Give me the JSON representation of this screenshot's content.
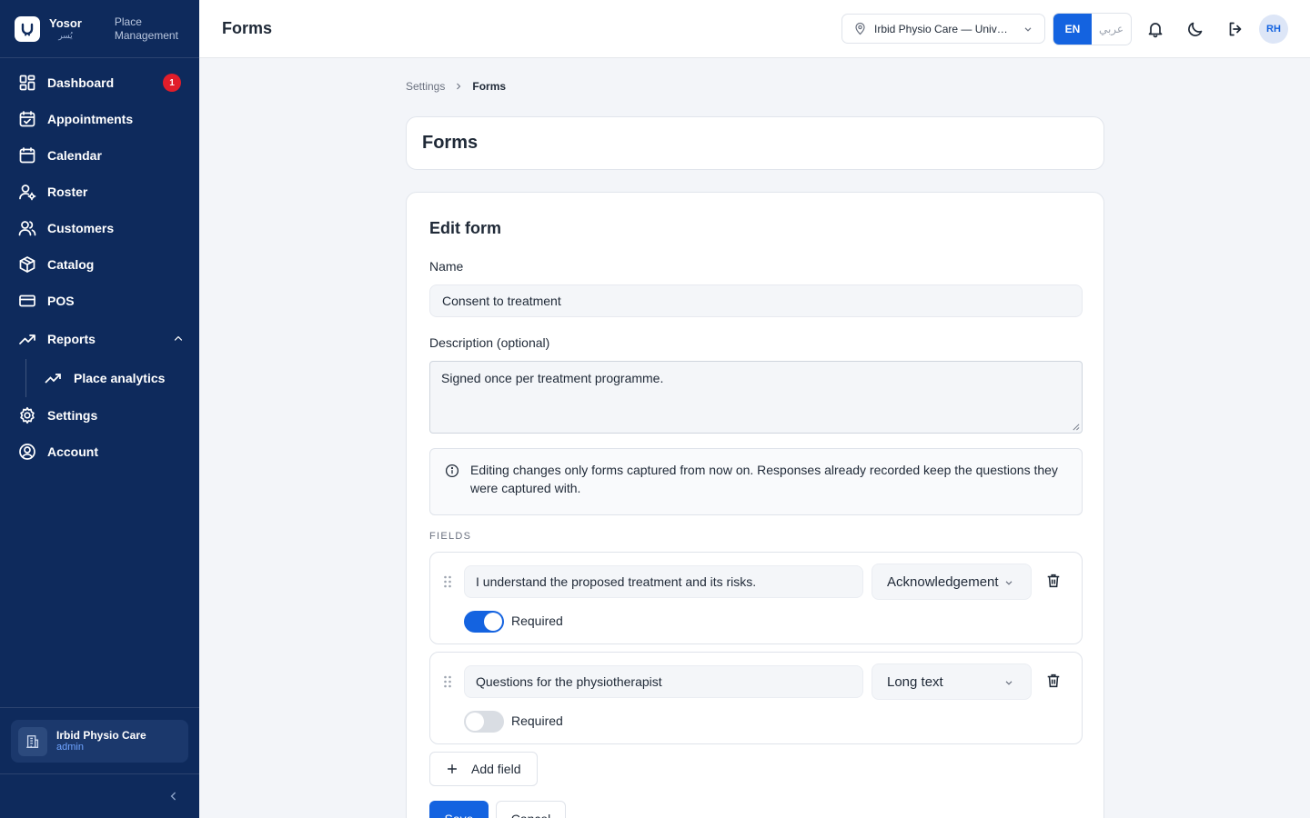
{
  "brand": {
    "name": "Yosor",
    "name_ar": "يُسر",
    "subtitle_line1": "Place",
    "subtitle_line2": "Management"
  },
  "sidebar": {
    "items": [
      {
        "label": "Dashboard",
        "icon": "dashboard-grid-icon",
        "badge": "1"
      },
      {
        "label": "Appointments",
        "icon": "calendar-check-icon"
      },
      {
        "label": "Calendar",
        "icon": "calendar-icon"
      },
      {
        "label": "Roster",
        "icon": "user-settings-icon"
      },
      {
        "label": "Customers",
        "icon": "users-icon"
      },
      {
        "label": "Catalog",
        "icon": "package-icon"
      },
      {
        "label": "POS",
        "icon": "credit-card-icon"
      },
      {
        "label": "Reports",
        "icon": "trending-up-icon",
        "expanded": true,
        "children": [
          {
            "label": "Place analytics",
            "icon": "trending-up-icon"
          }
        ]
      },
      {
        "label": "Settings",
        "icon": "gear-icon"
      },
      {
        "label": "Account",
        "icon": "user-circle-icon"
      }
    ],
    "place_card": {
      "name": "Irbid Physio Care",
      "role": "admin"
    }
  },
  "header": {
    "title": "Forms",
    "place_select": "Irbid Physio Care — University Street",
    "lang_en": "EN",
    "lang_ar": "عربي",
    "avatar": "RH"
  },
  "breadcrumb": {
    "parent": "Settings",
    "current": "Forms"
  },
  "page": {
    "title": "Forms"
  },
  "form": {
    "heading": "Edit form",
    "name_label": "Name",
    "name_value": "Consent to treatment",
    "description_label": "Description (optional)",
    "description_value": "Signed once per treatment programme.",
    "info_text": "Editing changes only forms captured from now on. Responses already recorded keep the questions they were captured with.",
    "fields_label": "FIELDS",
    "fields": [
      {
        "question": "I understand the proposed treatment and its risks.",
        "type": "Acknowledgement",
        "required_label": "Required",
        "required": true
      },
      {
        "question": "Questions for the physiotherapist",
        "type": "Long text",
        "required_label": "Required",
        "required": false
      }
    ],
    "add_field_label": "Add field",
    "save_label": "Save",
    "cancel_label": "Cancel"
  },
  "colors": {
    "sidebar_bg": "#0e2a5c",
    "accent": "#1463e0",
    "badge": "#e11d2a"
  }
}
